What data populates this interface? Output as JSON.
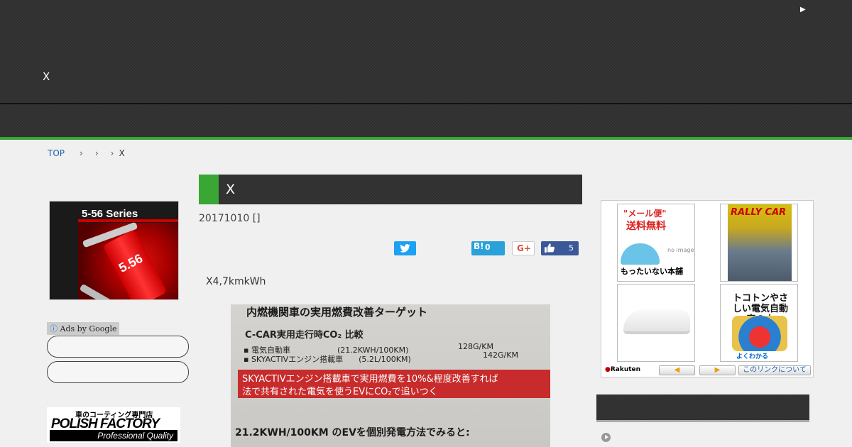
{
  "header": {
    "site_title": "X",
    "play_icon": "play-icon"
  },
  "breadcrumb": {
    "top_label": "TOP",
    "separator": "›",
    "current": "X"
  },
  "left_sidebar": {
    "ad_image": {
      "title": "5-56 Series",
      "can_label": "5.56"
    },
    "ads_by_google": "Ads by Google",
    "polish_factory": {
      "tagline": "車のコーティング専門店",
      "name": "POLISH FACTORY",
      "quality": "Professional Quality"
    }
  },
  "article": {
    "title": "X",
    "date": "20171010 []",
    "lead": "X4,7kmkWh",
    "share": {
      "hatena_label": "B!",
      "hatena_count": "0",
      "gplus_label": "G+",
      "facebook_count": "5"
    },
    "photo_text": {
      "line1": "内燃機関車の実用燃費改善ターゲット",
      "line2": "C-CAR実用走行時CO₂ 比較",
      "line3": "▪ 電気自動車　　　　　　(21.2KWH/100KM)",
      "line3_right": "128G/KM",
      "line4": "▪ SKYACTIVエンジン搭載車　　(5.2L/100KM)",
      "line4_right": "142G/KM",
      "red1": "SKYACTIVエンジン搭載車で実用燃費を10%&程度改善すれば",
      "red2": "法で共有された電気を使うEVにCO₂で追いつく",
      "line5": "21.2KWH/100KM のEVを個別発電方法でみると:"
    }
  },
  "rakuten": {
    "item1": {
      "title": "\"メール便\"",
      "subtitle": "送料無料",
      "noimage": "no image",
      "shop": "もったいない本舗"
    },
    "item2": {
      "title": "RALLY CAR"
    },
    "item4": {
      "title": "トコトンやさしい電気自動車の本",
      "subtitle": "よくわかる"
    },
    "logo": "Rakuten",
    "prev": "◀",
    "next": "▶",
    "about": "このリンクについて"
  },
  "colors": {
    "accent_green": "#3aa636",
    "header_dark": "#2e2e2e",
    "twitter": "#1da1f2",
    "hatena": "#2aa1d9",
    "facebook": "#3b5998"
  }
}
